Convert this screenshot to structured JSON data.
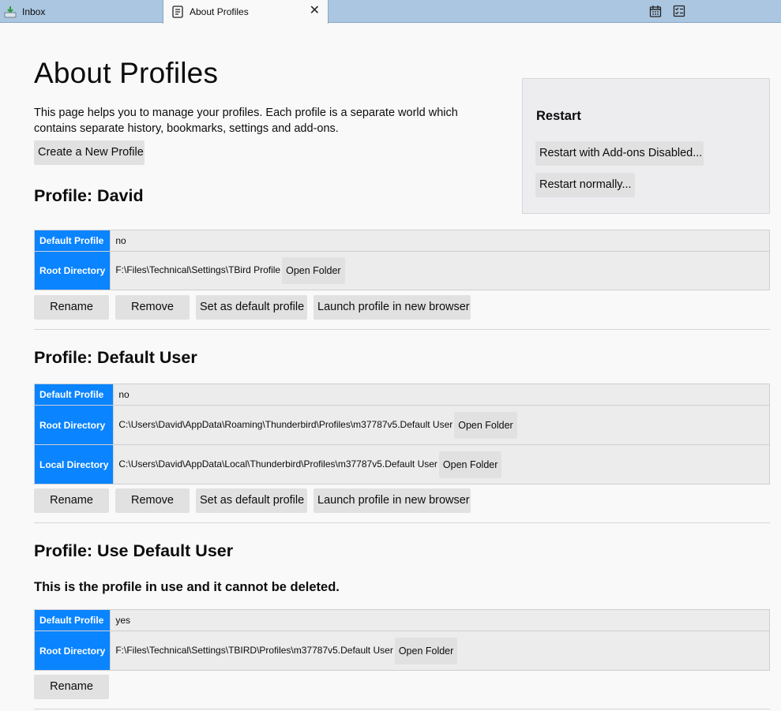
{
  "tabs": {
    "inbox": "Inbox",
    "about": "About Profiles",
    "close": "✕"
  },
  "page": {
    "title": "About Profiles",
    "intro": "This page helps you to manage your profiles. Each profile is a separate world which contains separate history, bookmarks, settings and add-ons.",
    "create_button": "Create a New Profile"
  },
  "restart": {
    "title": "Restart",
    "addons_disabled": "Restart with Add-ons Disabled...",
    "normally": "Restart normally..."
  },
  "labels": {
    "default_profile": "Default Profile",
    "root_directory": "Root Directory",
    "local_directory": "Local Directory",
    "open_folder": "Open Folder",
    "rename": "Rename",
    "remove": "Remove",
    "set_default": "Set as default profile",
    "launch": "Launch profile in new browser"
  },
  "profiles": [
    {
      "title": "Profile: David",
      "default": "no",
      "root": "F:\\Files\\Technical\\Settings\\TBird Profile"
    },
    {
      "title": "Profile: Default User",
      "default": "no",
      "root": "C:\\Users\\David\\AppData\\Roaming\\Thunderbird\\Profiles\\m37787v5.Default User",
      "local": "C:\\Users\\David\\AppData\\Local\\Thunderbird\\Profiles\\m37787v5.Default User"
    },
    {
      "title": "Profile: Use Default User",
      "note": "This is the profile in use and it cannot be deleted.",
      "default": "yes",
      "root": "F:\\Files\\Technical\\Settings\\TBIRD\\Profiles\\m37787v5.Default User"
    }
  ],
  "colors": {
    "accent": "#0a84ff",
    "tabbar": "#abc6e0",
    "button": "#e1e1e2"
  },
  "icons": [
    "inbox-icon",
    "document-icon",
    "close-icon",
    "calendar-icon",
    "tasks-icon"
  ]
}
